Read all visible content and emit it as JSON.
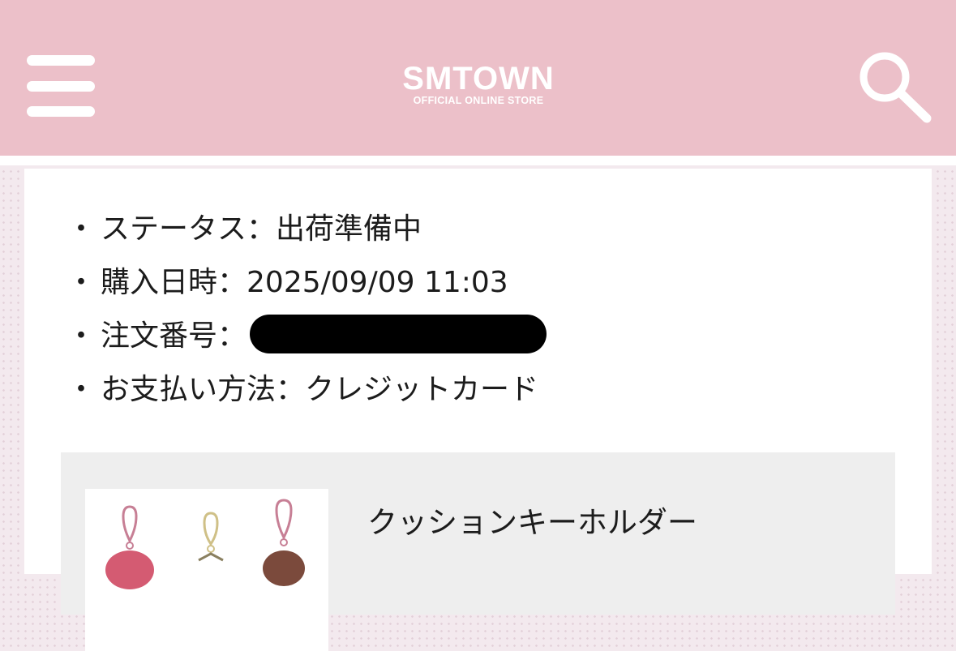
{
  "header": {
    "logo_main": "SMTOWN",
    "logo_sub": "OFFICIAL ONLINE STORE",
    "menu_icon": "hamburger-menu-icon",
    "search_icon": "search-icon",
    "background_color": "#ecc0c9"
  },
  "order_info": [
    {
      "label": "ステータス：",
      "value": "出荷準備中"
    },
    {
      "label": "購入日時：",
      "value": "2025/09/09 11:03"
    },
    {
      "label": "注文番号：",
      "value": ""
    },
    {
      "label": "お支払い方法：",
      "value": "クレジットカード"
    }
  ],
  "bullet": "・",
  "product": {
    "name": "クッションキーホルダー"
  }
}
